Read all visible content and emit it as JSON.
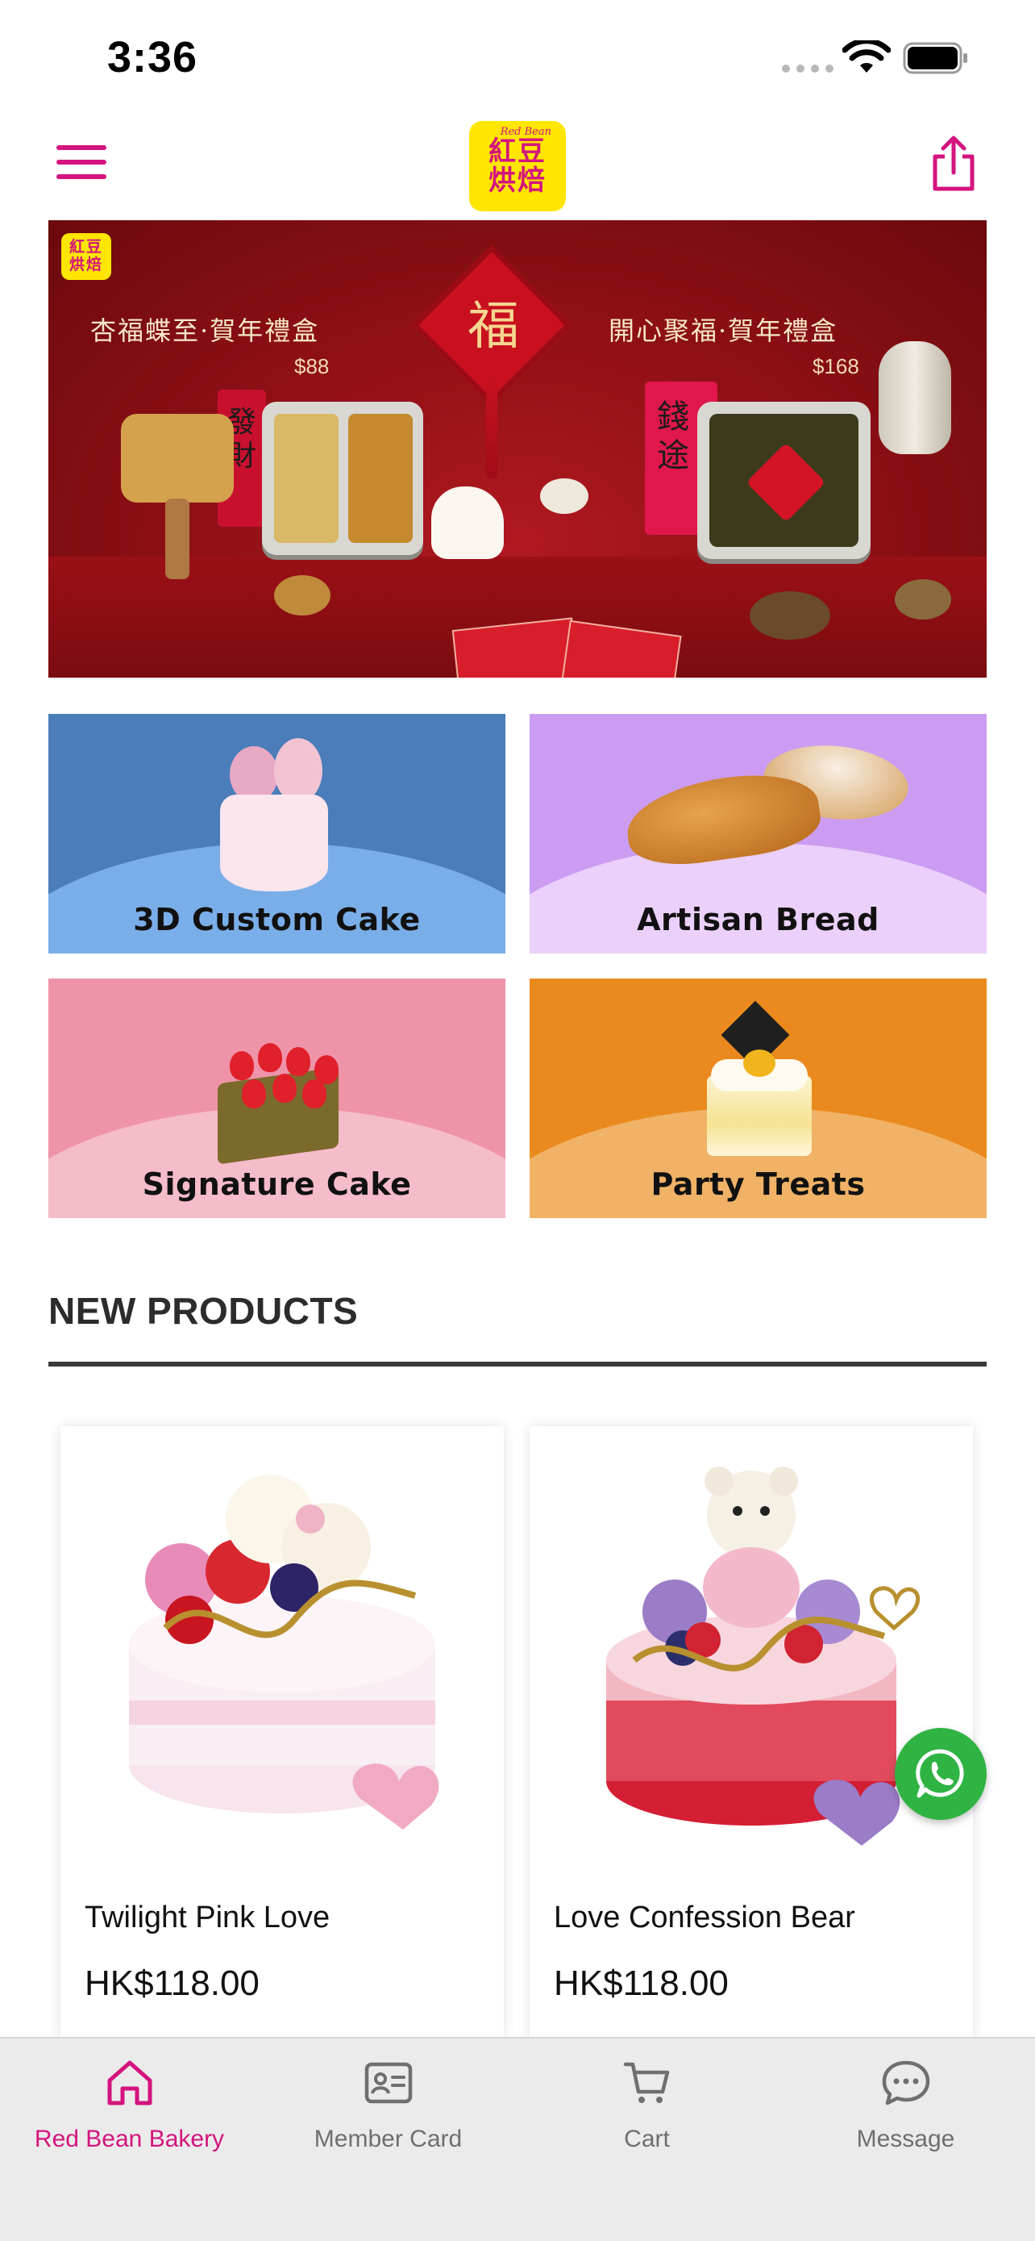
{
  "status_bar": {
    "time": "3:36"
  },
  "header": {
    "logo_small": "Red Bean",
    "logo_line1": "紅豆",
    "logo_line2": "烘焙"
  },
  "banner": {
    "badge_line1": "紅豆",
    "badge_line2": "烘焙",
    "fu": "福",
    "left_title": "杏福蝶至·賀年禮盒",
    "left_price": "$88",
    "right_title": "開心聚福·賀年禮盒",
    "right_price": "$168",
    "left_box_text": "發財",
    "right_box_text": "錢途"
  },
  "categories": [
    {
      "label": "3D Custom Cake",
      "bg": "#4a7db9",
      "arc": "#7aaee8"
    },
    {
      "label": "Artisan Bread",
      "bg": "#cc9cf2",
      "arc": "#ead0fb"
    },
    {
      "label": "Signature Cake",
      "bg": "#ef93a8",
      "arc": "#f5bcc9"
    },
    {
      "label": "Party Treats",
      "bg": "#ea8a1e",
      "arc": "#f0b266"
    }
  ],
  "new_products": {
    "title": "NEW PRODUCTS",
    "items": [
      {
        "name": "Twilight Pink Love",
        "price": "HK$118.00"
      },
      {
        "name": "Love Confession Bear",
        "price": "HK$118.00"
      }
    ]
  },
  "tabbar": {
    "items": [
      {
        "label": "Red Bean Bakery",
        "icon": "home-icon",
        "active": true
      },
      {
        "label": "Member Card",
        "icon": "member-card-icon",
        "active": false
      },
      {
        "label": "Cart",
        "icon": "cart-icon",
        "active": false
      },
      {
        "label": "Message",
        "icon": "message-icon",
        "active": false
      }
    ]
  },
  "colors": {
    "brand": "#d4147e",
    "logo_bg": "#ffe600",
    "whatsapp": "#2fb343"
  }
}
